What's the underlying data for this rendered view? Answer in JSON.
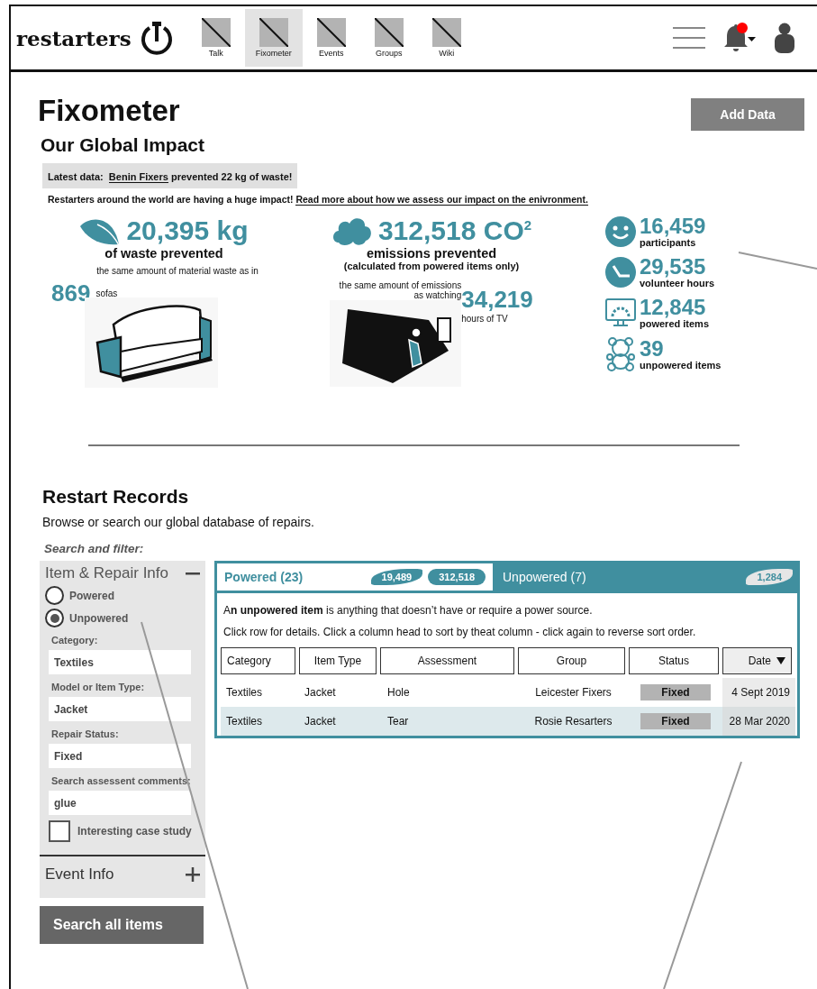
{
  "header": {
    "logo": "restarters",
    "nav": [
      {
        "label": "Talk",
        "selected": false
      },
      {
        "label": "Fixometer",
        "selected": true
      },
      {
        "label": "Events",
        "selected": false
      },
      {
        "label": "Groups",
        "selected": false
      },
      {
        "label": "Wiki",
        "selected": false
      }
    ],
    "notifications": {
      "unread": true
    }
  },
  "page": {
    "title": "Fixometer",
    "add_button": "Add Data"
  },
  "impact": {
    "heading": "Our Global Impact",
    "latest": {
      "prefix": "Latest data:",
      "link": "Benin Fixers",
      "suffix": "prevented 22 kg of waste!"
    },
    "intro": "Restarters around the world are having a huge impact!",
    "intro_link": "Read more about how we assess our impact on the enivronment.",
    "waste": {
      "value": "20,395 kg",
      "label": "of waste prevented",
      "comparison": "the same amount of material waste as in",
      "count": "869",
      "unit": "sofas"
    },
    "emissions": {
      "value": "312,518 CO$^{2}$",
      "label": "emissions prevented",
      "note": "(calculated from powered items only)",
      "comparison_1": "the same amount of emissions",
      "comparison_2": "as watching",
      "count": "34,219",
      "unit": "hours of TV"
    },
    "stats": [
      {
        "kind": "participants",
        "value": "16,459",
        "label": "participants"
      },
      {
        "kind": "hours",
        "value": "29,535",
        "label": "volunteer hours"
      },
      {
        "kind": "powered",
        "value": "12,845",
        "label": "powered items"
      },
      {
        "kind": "unpowered",
        "value": "39",
        "label": "unpowered items"
      }
    ]
  },
  "records": {
    "heading": "Restart Records",
    "description": "Browse or search our global database of repairs.",
    "filter_heading": "Search and filter:",
    "filter_sections": [
      {
        "title": "Item & Repair Info",
        "expanded": true,
        "radios": [
          {
            "label": "Powered",
            "selected": false
          },
          {
            "label": "Unpowered",
            "selected": true
          }
        ],
        "fields": [
          {
            "label": "Category:",
            "value": "Textiles"
          },
          {
            "label": "Model or Item Type:",
            "value": "Jacket"
          },
          {
            "label": "Repair Status:",
            "value": "Fixed"
          },
          {
            "label": "Search assessent comments:",
            "value": "glue"
          }
        ],
        "checkbox": {
          "label": "Interesting case study",
          "checked": false
        }
      },
      {
        "title": "Event Info",
        "expanded": false
      }
    ],
    "search_button": "Search all items",
    "tabs": [
      {
        "label": "Powered (23)",
        "selected": true,
        "badges": [
          {
            "kind": "leaf",
            "value": "19,489"
          },
          {
            "kind": "cloud",
            "value": "312,518"
          }
        ]
      },
      {
        "label": "Unpowered (7)",
        "selected": false,
        "badges": [
          {
            "kind": "leaf",
            "value": "1,284"
          }
        ]
      }
    ],
    "definition": "A**n unpowered item** is anything that doesn’t have or require a power source.",
    "help": "Click row for details. Click a column head to sort by theat column - click again to reverse sort order.",
    "columns": [
      {
        "label": "Category",
        "sorted": false
      },
      {
        "label": "Item Type",
        "sorted": false
      },
      {
        "label": "Assessment",
        "sorted": false
      },
      {
        "label": "Group",
        "sorted": false
      },
      {
        "label": "Status",
        "sorted": false
      },
      {
        "label": "Date",
        "sorted": true
      }
    ],
    "rows": [
      {
        "cells": [
          "Textiles",
          "Jacket",
          "Hole",
          "Leicester Fixers",
          "Fixed",
          "4 Sept 2019"
        ],
        "selected": false
      },
      {
        "cells": [
          "Textiles",
          "Jacket",
          "Tear",
          "Rosie Resarters",
          "Fixed",
          "28 Mar 2020"
        ],
        "selected": true
      }
    ]
  }
}
